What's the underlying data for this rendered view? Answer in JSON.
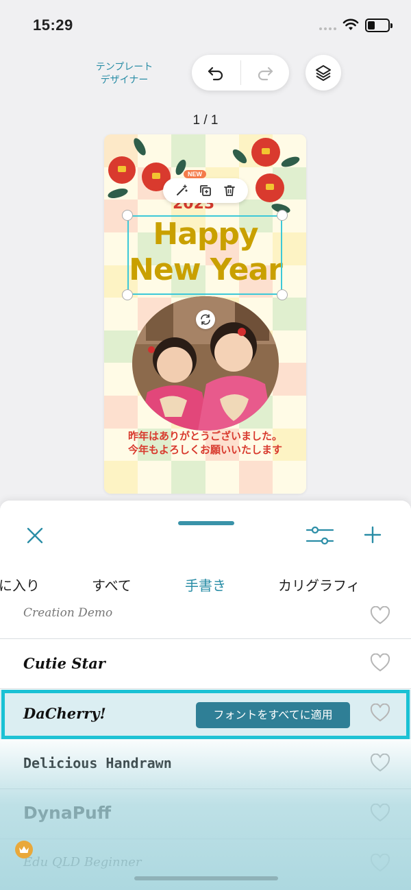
{
  "status_bar": {
    "time": "15:29"
  },
  "toolbar": {
    "designer_label_line1": "テンプレート",
    "designer_label_line2": "デザイナー",
    "undo_icon": "undo-icon",
    "redo_icon": "redo-icon",
    "layers_icon": "layers-icon"
  },
  "page_indicator": "1 / 1",
  "card": {
    "year": "2023",
    "headline_line1": "Happy",
    "headline_line2": "New Year",
    "new_badge": "NEW",
    "message_line1": "昨年はありがとうございました。",
    "message_line2": "今年もよろしくお願いいたします"
  },
  "sheet": {
    "tabs": [
      "に入り",
      "すべて",
      "手書き",
      "カリグラフィ"
    ],
    "active_tab_index": 2,
    "fonts": [
      {
        "name": "Creation Demo",
        "favorited": false
      },
      {
        "name": "Cutie Star",
        "favorited": false
      },
      {
        "name": "DaCherry!",
        "favorited": false,
        "selected": true
      },
      {
        "name": "Delicious Handrawn",
        "favorited": false
      },
      {
        "name": "DynaPuff",
        "favorited": false
      },
      {
        "name": "Edu QLD Beginner",
        "favorited": false,
        "premium": true
      }
    ],
    "apply_all_label": "フォントをすべてに適用"
  },
  "colors": {
    "accent": "#2a8da6",
    "selection": "#19c1d4",
    "headline": "#c9a000",
    "red": "#d83a2e"
  }
}
